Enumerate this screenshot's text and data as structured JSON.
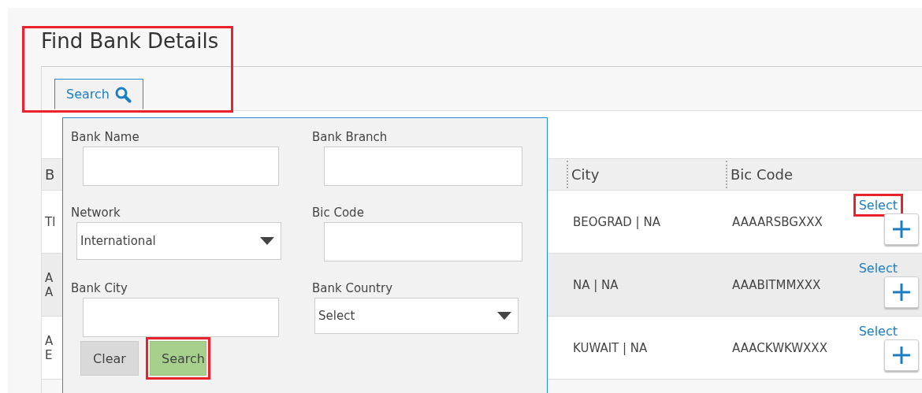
{
  "title": {
    "text": "Find Bank Details",
    "highlighted": true
  },
  "search_tab": {
    "label": "Search",
    "selected": true
  },
  "search_form": {
    "fields": [
      {
        "label": "Bank Name",
        "kind": "text"
      },
      {
        "label": "Bank Branch",
        "kind": "text"
      },
      {
        "label": "Network",
        "kind": "select",
        "value": "International"
      },
      {
        "label": "Bic Code",
        "kind": "text"
      },
      {
        "label": "Bank City",
        "kind": "text"
      },
      {
        "label": "Bank Country",
        "kind": "select",
        "value": "Select"
      }
    ],
    "buttons": [
      {
        "label": "Clear",
        "kind": "secondary",
        "highlighted": false
      },
      {
        "label": "Search",
        "kind": "primary",
        "highlighted": true
      }
    ]
  },
  "table": {
    "columns": [
      "B",
      "City",
      "Bic Code"
    ],
    "rows": [
      {
        "column_1": [
          "Tl"
        ],
        "city": "BEOGRAD | NA",
        "bic_code": "AAAARSBGXXX",
        "action": "Select",
        "highlighted": true
      },
      {
        "column_1": [
          "A",
          "A"
        ],
        "city": "NA | NA",
        "bic_code": "AAABITMMXXX",
        "action": "Select",
        "highlighted": false
      },
      {
        "column_1": [
          "A",
          "E"
        ],
        "city": "KUWAIT | NA",
        "bic_code": "AAACKWKWXXX",
        "action": "Select",
        "highlighted": false
      }
    ]
  }
}
